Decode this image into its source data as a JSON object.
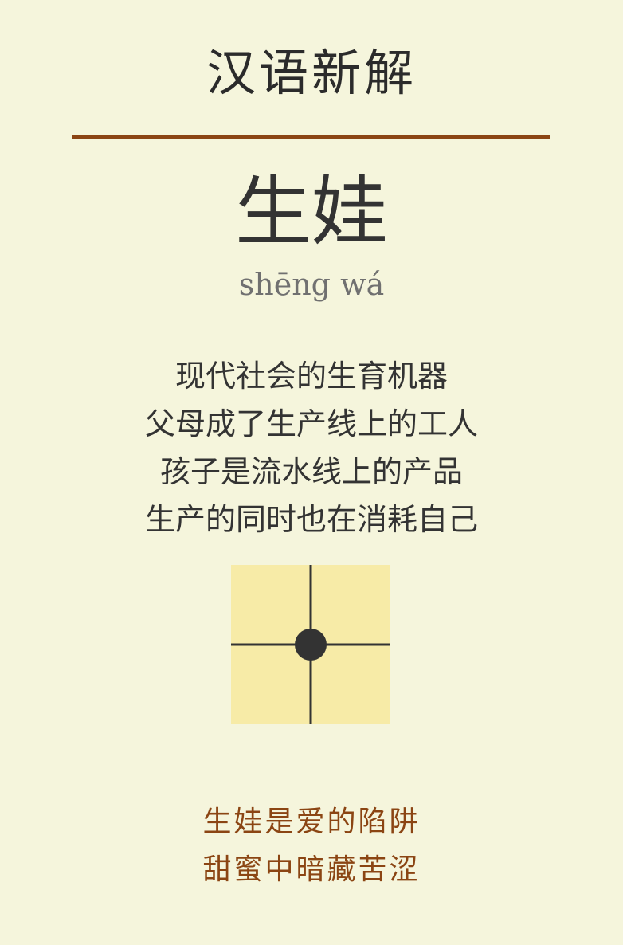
{
  "header": {
    "title": "汉语新解"
  },
  "entry": {
    "word": "生娃",
    "pinyin": "shēng wá",
    "explanation_lines": [
      "现代社会的生育机器",
      "父母成了生产线上的工人",
      "孩子是流水线上的产品",
      "生产的同时也在消耗自己"
    ]
  },
  "caption": {
    "lines": [
      "生娃是爱的陷阱",
      "甜蜜中暗藏苦涩"
    ]
  },
  "colors": {
    "background": "#f5f5dc",
    "accent": "#8b4513",
    "board_fill": "#f7eba7",
    "ink": "#333333"
  }
}
